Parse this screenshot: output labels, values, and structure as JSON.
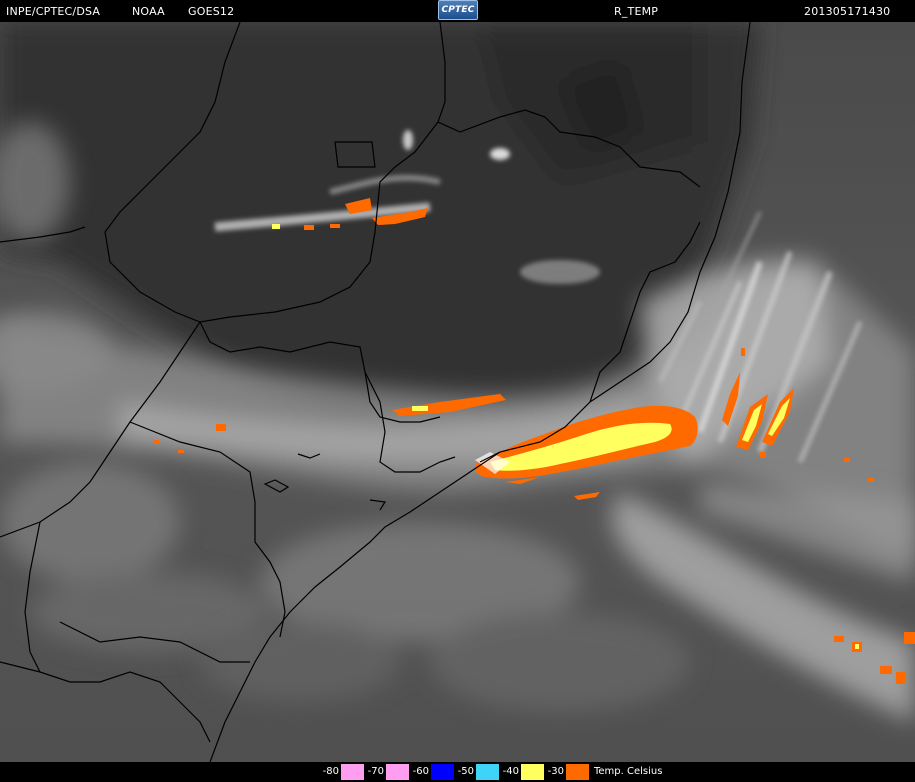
{
  "header": {
    "institution": "INPE/CPTEC/DSA",
    "agency": "NOAA",
    "satellite": "GOES12",
    "logo_text": "CPTEC",
    "product": "R_TEMP",
    "timestamp": "201305171430"
  },
  "legend": {
    "items": [
      {
        "label": "-80",
        "color": "#ff9ef0"
      },
      {
        "label": "-70",
        "color": "#ff9ef0"
      },
      {
        "label": "-60",
        "color": "#0000ff"
      },
      {
        "label": "-50",
        "color": "#3fd3f7"
      },
      {
        "label": "-40",
        "color": "#ffff60"
      },
      {
        "label": "-30",
        "color": "#ff6a00"
      }
    ],
    "unit": "Temp. Celsius"
  },
  "colors": {
    "cold_core": "#ffff60",
    "cold_edge": "#ff6a00",
    "cloud": "#d9d9d9",
    "land": "#3c3c3c",
    "ocean": "#6a6a6a",
    "borders": "#000000"
  }
}
